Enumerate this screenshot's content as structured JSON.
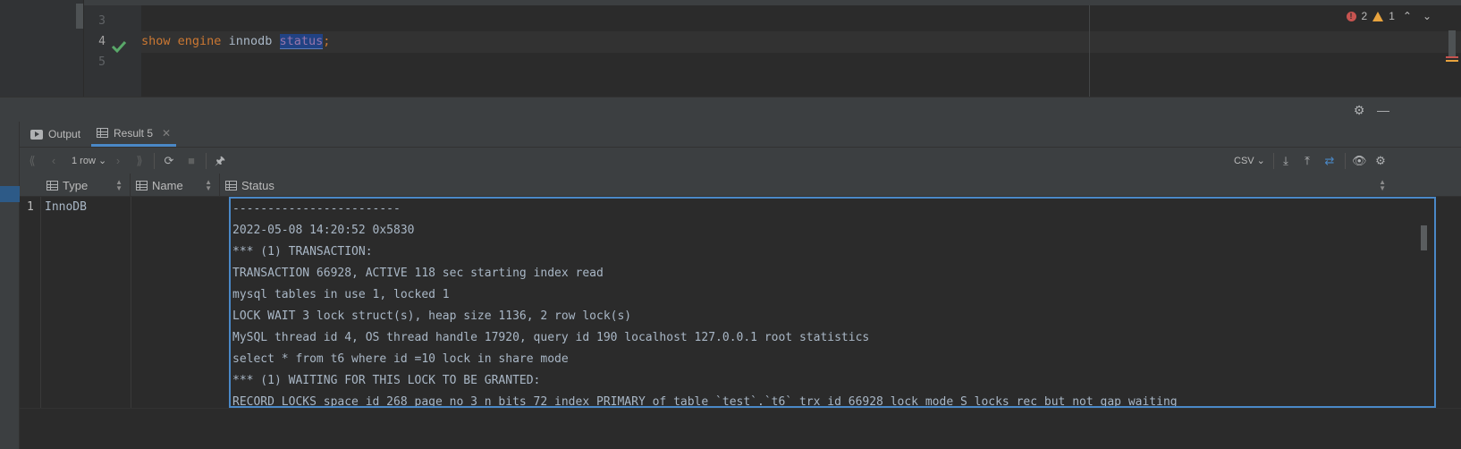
{
  "editor": {
    "line_numbers": [
      "3",
      "4",
      "5"
    ],
    "code": {
      "kw_show": "show",
      "kw_engine": "engine",
      "text_innodb": "innodb",
      "kw_status": "status",
      "semicolon": ";"
    },
    "inspections": {
      "errors": "2",
      "warnings": "1"
    }
  },
  "results": {
    "tabs": [
      {
        "label": "Output",
        "icon": "console-icon"
      },
      {
        "label": "Result 5",
        "icon": "table-icon"
      }
    ],
    "toolbar": {
      "row_count": "1 row",
      "export_format": "CSV"
    },
    "columns": [
      {
        "label": "Type",
        "icon": "column-icon"
      },
      {
        "label": "Name",
        "icon": "column-icon"
      },
      {
        "label": "Status",
        "icon": "column-icon"
      }
    ],
    "rows": [
      {
        "num": "1",
        "type": "InnoDB",
        "name": "",
        "status_lines": [
          "------------------------",
          "2022-05-08 14:20:52 0x5830",
          "*** (1) TRANSACTION:",
          "TRANSACTION 66928, ACTIVE 118 sec starting index read",
          "mysql tables in use 1, locked 1",
          "LOCK WAIT 3 lock struct(s), heap size 1136, 2 row lock(s)",
          "MySQL thread id 4, OS thread handle 17920, query id 190 localhost 127.0.0.1 root statistics",
          "select * from t6 where id =10 lock in share mode",
          "*** (1) WAITING FOR THIS LOCK TO BE GRANTED:",
          "RECORD LOCKS space id 268 page no 3 n bits 72 index PRIMARY of table `test`.`t6` trx id 66928 lock mode S locks rec but not gap waiting"
        ]
      }
    ]
  },
  "colors": {
    "accent": "#4a88c7",
    "keyword": "#cc7832",
    "error": "#c75450",
    "warning": "#e8a33e",
    "success": "#59a869"
  }
}
